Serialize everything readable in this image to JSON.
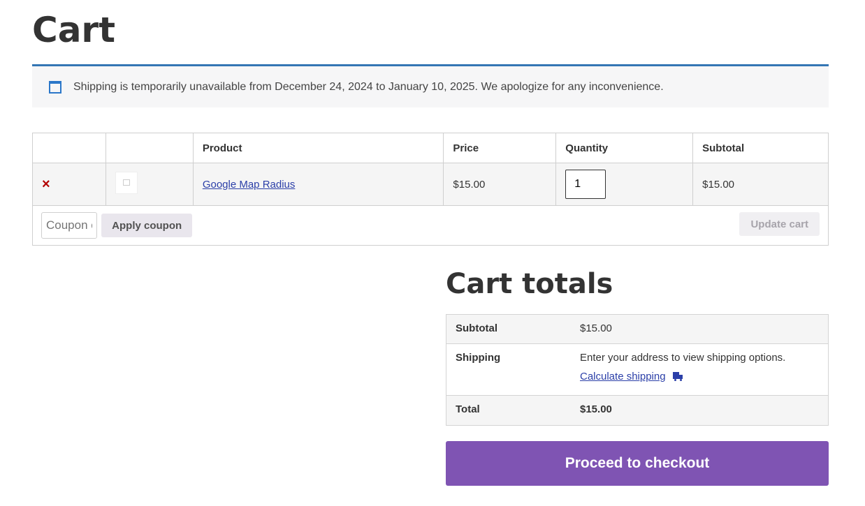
{
  "page": {
    "title": "Cart"
  },
  "notice": {
    "text": "Shipping is temporarily unavailable from December 24, 2024 to January 10, 2025. We apologize for any inconvenience.",
    "accent_color": "#3476b4",
    "icon": "calendar-icon"
  },
  "cart_table": {
    "headers": {
      "remove": "",
      "thumbnail": "",
      "product": "Product",
      "price": "Price",
      "quantity": "Quantity",
      "subtotal": "Subtotal"
    },
    "items": [
      {
        "remove_symbol": "×",
        "product_name": "Google Map Radius",
        "price": "$15.00",
        "quantity": "1",
        "subtotal": "$15.00"
      }
    ],
    "coupon_placeholder": "Coupon code",
    "apply_coupon_label": "Apply coupon",
    "update_cart_label": "Update cart"
  },
  "totals": {
    "title": "Cart totals",
    "subtotal_label": "Subtotal",
    "subtotal_value": "$15.00",
    "shipping_label": "Shipping",
    "shipping_message": "Enter your address to view shipping options.",
    "calculate_shipping_label": "Calculate shipping",
    "total_label": "Total",
    "total_value": "$15.00"
  },
  "checkout": {
    "label": "Proceed to checkout",
    "color": "#7f54b3"
  }
}
